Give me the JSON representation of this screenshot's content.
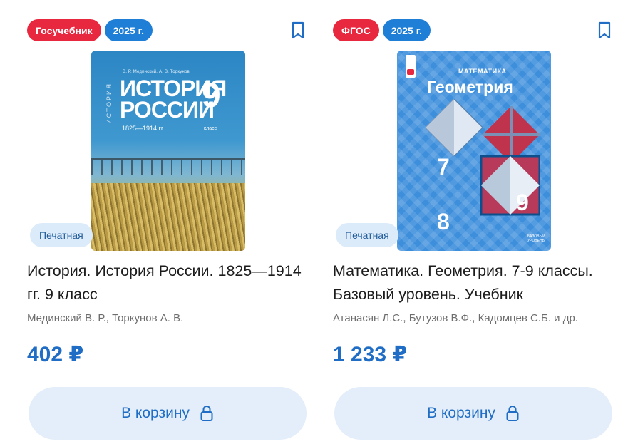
{
  "products": [
    {
      "badges": [
        "Госучебник",
        "2025 г."
      ],
      "format": "Печатная",
      "title": "История. История России. 1825—1914 гг. 9 класс",
      "authors": "Мединский В. Р., Торкунов А. В.",
      "price": "402 ₽",
      "cart_label": "В корзину",
      "cover": {
        "authors": "В. Р. Мединский, А. В. Торкунов",
        "title_line1": "ИСТОРИЯ",
        "title_line2": "РОССИИ",
        "grade": "9",
        "grade_label": "класс",
        "years": "1825—1914 гг.",
        "spine": "ИСТОРИЯ"
      }
    },
    {
      "badges": [
        "ФГОС",
        "2025 г."
      ],
      "format": "Печатная",
      "title": "Математика. Геометрия. 7-9 классы. Базовый уровень. Учебник",
      "authors": "Атанасян Л.С., Бутузов В.Ф., Кадомцев С.Б. и др.",
      "price": "1 233 ₽",
      "cart_label": "В корзину",
      "cover": {
        "subject": "МАТЕМАТИКА",
        "title": "Геометрия",
        "num7": "7",
        "num8": "8",
        "num9": "9",
        "level": "БАЗОВЫЙ УРОВЕНЬ"
      }
    }
  ],
  "colors": {
    "badge_red": "#e8283f",
    "badge_blue": "#1f7fd6",
    "accent": "#1f6dc4",
    "button_bg": "#e3eefa"
  },
  "icons": [
    "bookmark-icon",
    "lock-icon"
  ]
}
